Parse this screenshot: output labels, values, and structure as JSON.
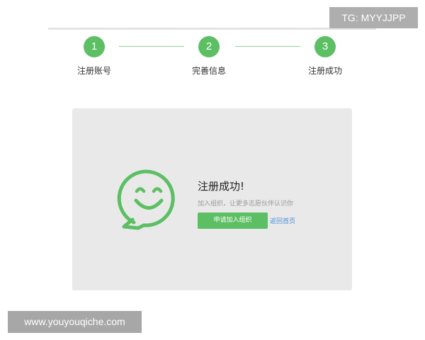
{
  "steps": [
    {
      "number": "1",
      "label": "注册账号"
    },
    {
      "number": "2",
      "label": "完善信息"
    },
    {
      "number": "3",
      "label": "注册成功"
    }
  ],
  "result": {
    "title": "注册成功!",
    "subtitle": "加入组织，让更多志愿伙伴认识你",
    "join_button": "申请加入组织",
    "home_link": "返回首页"
  },
  "watermarks": {
    "top_right": "TG: MYYJJPP",
    "bottom_left": "www.youyouqiche.com"
  },
  "colors": {
    "accent": "#5cbf63",
    "link": "#4a90d9",
    "card_bg": "#e9e9e9"
  }
}
